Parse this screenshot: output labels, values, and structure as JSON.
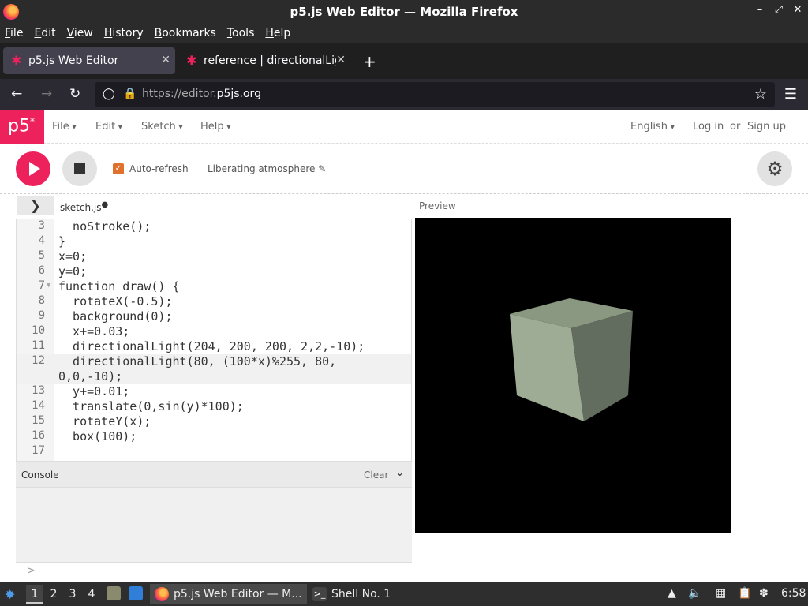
{
  "window": {
    "title": "p5.js Web Editor — Mozilla Firefox"
  },
  "menubar": {
    "items": [
      "File",
      "Edit",
      "View",
      "History",
      "Bookmarks",
      "Tools",
      "Help"
    ]
  },
  "tabs": [
    {
      "label": "p5.js Web Editor",
      "active": true
    },
    {
      "label": "reference | directionalLig",
      "active": false
    }
  ],
  "navbar": {
    "url_scheme": "https://editor.",
    "url_host": "p5js.org"
  },
  "p5": {
    "logo": "p5",
    "logo_sup": "*",
    "menus": [
      "File",
      "Edit",
      "Sketch",
      "Help"
    ],
    "language": "English",
    "login": "Log in",
    "or": "or",
    "signup": "Sign up",
    "autorefresh_label": "Auto-refresh",
    "project_name": "Liberating atmosphere",
    "file_tab": "sketch.js",
    "preview_label": "Preview",
    "accent_color": "#ed225d"
  },
  "editor": {
    "lines": [
      {
        "n": "3",
        "code": "  noStroke();"
      },
      {
        "n": "4",
        "code": "}"
      },
      {
        "n": "5",
        "code": "x=0;"
      },
      {
        "n": "6",
        "code": "y=0;"
      },
      {
        "n": "7",
        "code": "function draw() {",
        "fold": true
      },
      {
        "n": "8",
        "code": "  rotateX(-0.5);"
      },
      {
        "n": "9",
        "code": "  background(0);"
      },
      {
        "n": "10",
        "code": "  x+=0.03;"
      },
      {
        "n": "11",
        "code": "  directionalLight(204, 200, 200, 2,2,-10);"
      },
      {
        "n": "12",
        "code": "  directionalLight(80, (100*x)%255, 80,",
        "highlight": true
      },
      {
        "n": "",
        "code": "0,0,-10);",
        "highlight": true
      },
      {
        "n": "13",
        "code": "  y+=0.01;"
      },
      {
        "n": "14",
        "code": "  translate(0,sin(y)*100);"
      },
      {
        "n": "15",
        "code": "  rotateY(x);"
      },
      {
        "n": "16",
        "code": "  box(100);"
      },
      {
        "n": "17",
        "code": ""
      }
    ]
  },
  "console": {
    "title": "Console",
    "clear": "Clear",
    "prompt": ">"
  },
  "taskbar": {
    "workspaces": [
      "1",
      "2",
      "3",
      "4"
    ],
    "windows": [
      {
        "label": "p5.js Web Editor — M...",
        "active": true
      },
      {
        "label": "Shell No. 1",
        "active": false
      }
    ],
    "clock": "6:58"
  }
}
